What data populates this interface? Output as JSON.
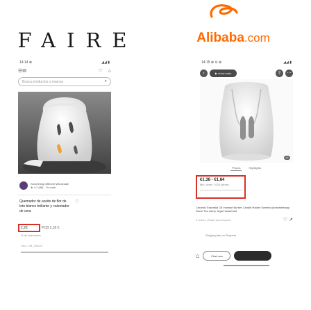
{
  "left": {
    "brand": "FAIRE",
    "status_time": "14:14 ⊕",
    "status_right": "◢◢ ▮",
    "search_placeholder": "Busca productos o marcas",
    "seller_text": "Something Different Wholesale",
    "seller_sub": "★ 4.7 (88) · To order",
    "title": "Quemador de aceite de flor de loto blanco brillante y calentador de cera",
    "price": "2,2€",
    "price_rest": "PCB 2,35 €",
    "price_sub": "% de descuento",
    "sku": "SKU: OB_032227"
  },
  "right": {
    "brand_main": "Alibaba",
    "brand_dot": ".com",
    "status_time": "14:15 ⊕ ⊙ ⊕",
    "status_right": "◢◢ ▮",
    "show_label": "▶ show main",
    "thumb_counter": "1/7",
    "tabs": [
      "Photos",
      "Highlights"
    ],
    "tier_price": "€1.38 - €1.84",
    "tier_sub": "Min. order: 1000 pieces",
    "title": "Ceramic Essential Oil Incense Burner Candle Holder Scented Aromatherapy Stove Tea Lamp Yoga Household",
    "meta": "0 orders | Sales and reviews",
    "shipping": "Shipping fee on Request",
    "chat_btn": "Chat now"
  }
}
